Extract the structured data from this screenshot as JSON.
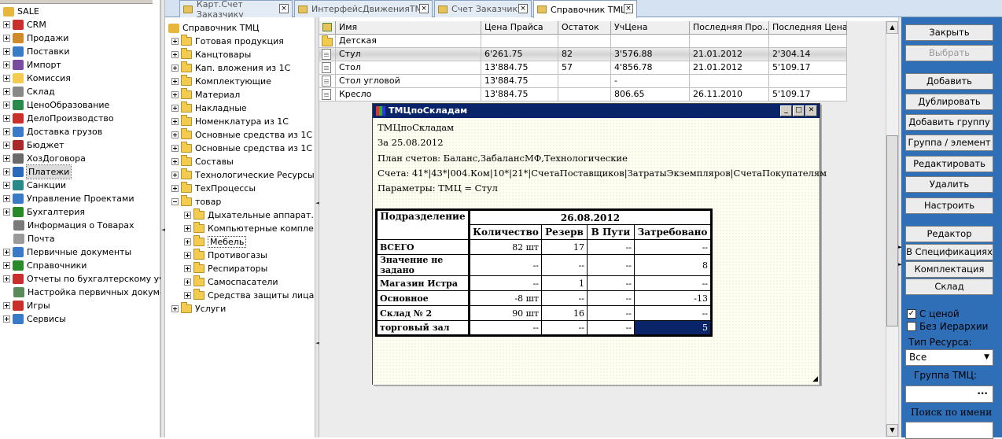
{
  "left_tree": {
    "root": "SALE",
    "items": [
      {
        "label": "CRM",
        "icon": "crm-icon",
        "expand": true
      },
      {
        "label": "Продажи",
        "icon": "sales-icon",
        "expand": true
      },
      {
        "label": "Поставки",
        "icon": "supply-icon",
        "expand": true
      },
      {
        "label": "Импорт",
        "icon": "import-icon",
        "expand": true
      },
      {
        "label": "Комиссия",
        "icon": "folder-icon",
        "expand": true
      },
      {
        "label": "Склад",
        "icon": "warehouse-icon",
        "expand": true
      },
      {
        "label": "ЦеноОбразование",
        "icon": "pricing-icon",
        "expand": true
      },
      {
        "label": "ДелоПроизводство",
        "icon": "docflow-icon",
        "expand": true
      },
      {
        "label": "Доставка грузов",
        "icon": "delivery-icon",
        "expand": true
      },
      {
        "label": "Бюджет",
        "icon": "budget-icon",
        "expand": true
      },
      {
        "label": "ХозДоговора",
        "icon": "contracts-icon",
        "expand": true
      },
      {
        "label": "Платежи",
        "icon": "payments-icon",
        "expand": true,
        "selected": true
      },
      {
        "label": "Санкции",
        "icon": "sanctions-icon",
        "expand": true
      },
      {
        "label": "Управление Проектами",
        "icon": "projects-icon",
        "expand": true
      },
      {
        "label": "Бухгалтерия",
        "icon": "accounting-icon",
        "expand": true
      },
      {
        "label": "Информация о Товарах",
        "icon": "info-icon",
        "expand": false
      },
      {
        "label": "Почта",
        "icon": "mail-icon",
        "expand": false
      },
      {
        "label": "Первичные документы",
        "icon": "documents-icon",
        "expand": true
      },
      {
        "label": "Справочники",
        "icon": "reference-icon",
        "expand": true
      },
      {
        "label": "Отчеты по бухгалтерскому уче...",
        "icon": "reports-icon",
        "expand": true
      },
      {
        "label": "Настройка первичных докумен...",
        "icon": "settings-icon",
        "expand": false
      },
      {
        "label": "Игры",
        "icon": "games-icon",
        "expand": true
      },
      {
        "label": "Сервисы",
        "icon": "services-icon",
        "expand": true
      }
    ]
  },
  "tabs": [
    {
      "label": "Карт.Счет Заказчику",
      "active": false
    },
    {
      "label": "ИнтерфейсДвиженияТМЦ",
      "active": false
    },
    {
      "label": "Счет Заказчику",
      "active": false
    },
    {
      "label": "Справочник ТМЦ",
      "active": true
    }
  ],
  "mid_tree": {
    "root": "Справочник ТМЦ",
    "items": [
      {
        "label": "Готовая продукция",
        "level": 1,
        "expand": "plus"
      },
      {
        "label": "Канцтовары",
        "level": 1,
        "expand": "plus"
      },
      {
        "label": "Кап. вложения из 1С",
        "level": 1,
        "expand": "plus"
      },
      {
        "label": "Комплектующие",
        "level": 1,
        "expand": "plus"
      },
      {
        "label": "Материал",
        "level": 1,
        "expand": "plus"
      },
      {
        "label": "Накладные",
        "level": 1,
        "expand": "plus"
      },
      {
        "label": "Номенклатура из 1С",
        "level": 1,
        "expand": "plus"
      },
      {
        "label": "Основные средства из 1С",
        "level": 1,
        "expand": "plus"
      },
      {
        "label": "Основные средства из 1С",
        "level": 1,
        "expand": "plus"
      },
      {
        "label": "Составы",
        "level": 1,
        "expand": "plus"
      },
      {
        "label": "Технологические Ресурсы",
        "level": 1,
        "expand": "plus"
      },
      {
        "label": "ТехПроцессы",
        "level": 1,
        "expand": "plus"
      },
      {
        "label": "товар",
        "level": 1,
        "expand": "minus"
      },
      {
        "label": "Дыхательные аппарат...",
        "level": 2,
        "expand": "plus"
      },
      {
        "label": "Компьютерные компле...",
        "level": 2,
        "expand": "plus"
      },
      {
        "label": "Мебель",
        "level": 2,
        "expand": "plus",
        "selected": true
      },
      {
        "label": "Противогазы",
        "level": 2,
        "expand": "plus"
      },
      {
        "label": "Респираторы",
        "level": 2,
        "expand": "plus"
      },
      {
        "label": "Самоспасатели",
        "level": 2,
        "expand": "plus"
      },
      {
        "label": "Средства защиты лица...",
        "level": 2,
        "expand": "plus"
      },
      {
        "label": "Услуги",
        "level": 1,
        "expand": "plus"
      }
    ]
  },
  "grid": {
    "columns": [
      "Имя",
      "Цена Прайса",
      "Остаток",
      "УчЦена",
      "Последняя Про...",
      "Последняя Цена"
    ],
    "rows": [
      {
        "type": "folder",
        "cells": [
          "Детская",
          "",
          "",
          "",
          "",
          ""
        ]
      },
      {
        "type": "item",
        "current": true,
        "cells": [
          "Стул",
          "6'261.75",
          "82",
          "3'576.88",
          "21.01.2012",
          "2'304.14"
        ]
      },
      {
        "type": "item",
        "cells": [
          "Стол",
          "13'884.75",
          "57",
          "4'856.78",
          "21.01.2012",
          "5'109.17"
        ]
      },
      {
        "type": "item",
        "cells": [
          "Стол угловой",
          "13'884.75",
          "",
          "-",
          "",
          ""
        ]
      },
      {
        "type": "item",
        "cells": [
          "Кресло",
          "13'884.75",
          "",
          "806.65",
          "26.11.2010",
          "5'109.17"
        ]
      }
    ]
  },
  "right_panel": {
    "buttons": [
      {
        "label": "Закрыть",
        "disabled": false
      },
      {
        "label": "Выбрать",
        "disabled": true
      },
      {
        "label": "Добавить",
        "disabled": false
      },
      {
        "label": "Дублировать",
        "disabled": false
      },
      {
        "label": "Добавить группу",
        "disabled": false
      },
      {
        "label": "Группа / элемент",
        "disabled": false
      },
      {
        "label": "Редактировать",
        "disabled": false
      },
      {
        "label": "Удалить",
        "disabled": false
      },
      {
        "label": "Настроить",
        "disabled": false
      },
      {
        "label": "Редактор",
        "disabled": false
      },
      {
        "label": "В Спецификациях",
        "disabled": false
      },
      {
        "label": "Комплектация",
        "disabled": false
      },
      {
        "label": "Склад",
        "disabled": false
      }
    ],
    "with_price": {
      "label": "С ценой",
      "checked": true
    },
    "no_hierarchy": {
      "label": "Без Иерархии",
      "checked": false
    },
    "resource_type_label": "Тип Ресурса:",
    "resource_type_value": "Все",
    "group_label": "Группа ТМЦ:",
    "group_button": "...",
    "search_label": "Поиск по имени"
  },
  "popup": {
    "title": "ТМЦпоСкладам",
    "lines": [
      "ТМЦпоСкладам",
      "За 25.08.2012",
      "План счетов: Баланс,ЗабалансМФ,Технологические",
      "Счета: 41*|43*|004.Ком|10*|21*|СчетаПоставщиков|ЗатратыЭкземпляров|СчетаПокупателям",
      "Параметры: ТМЦ = Стул"
    ],
    "table": {
      "corner": "Подразделение",
      "date": "26.08.2012",
      "columns": [
        "Количество",
        "Резерв",
        "В Пути",
        "Затребовано"
      ],
      "rows": [
        {
          "label": "ВСЕГО",
          "cells": [
            "82   шт",
            "17",
            "--",
            "--"
          ]
        },
        {
          "label": "Значение не задано",
          "cells": [
            "--",
            "--",
            "--",
            "8"
          ]
        },
        {
          "label": "Магазин Истра",
          "cells": [
            "--",
            "1",
            "--",
            "--"
          ]
        },
        {
          "label": "Основное",
          "cells": [
            "-8   шт",
            "--",
            "--",
            "-13"
          ]
        },
        {
          "label": "Склад № 2",
          "cells": [
            "90   шт",
            "16",
            "--",
            "--"
          ]
        },
        {
          "label": "торговый зал",
          "cells": [
            "--",
            "--",
            "--",
            "5"
          ]
        }
      ]
    }
  }
}
